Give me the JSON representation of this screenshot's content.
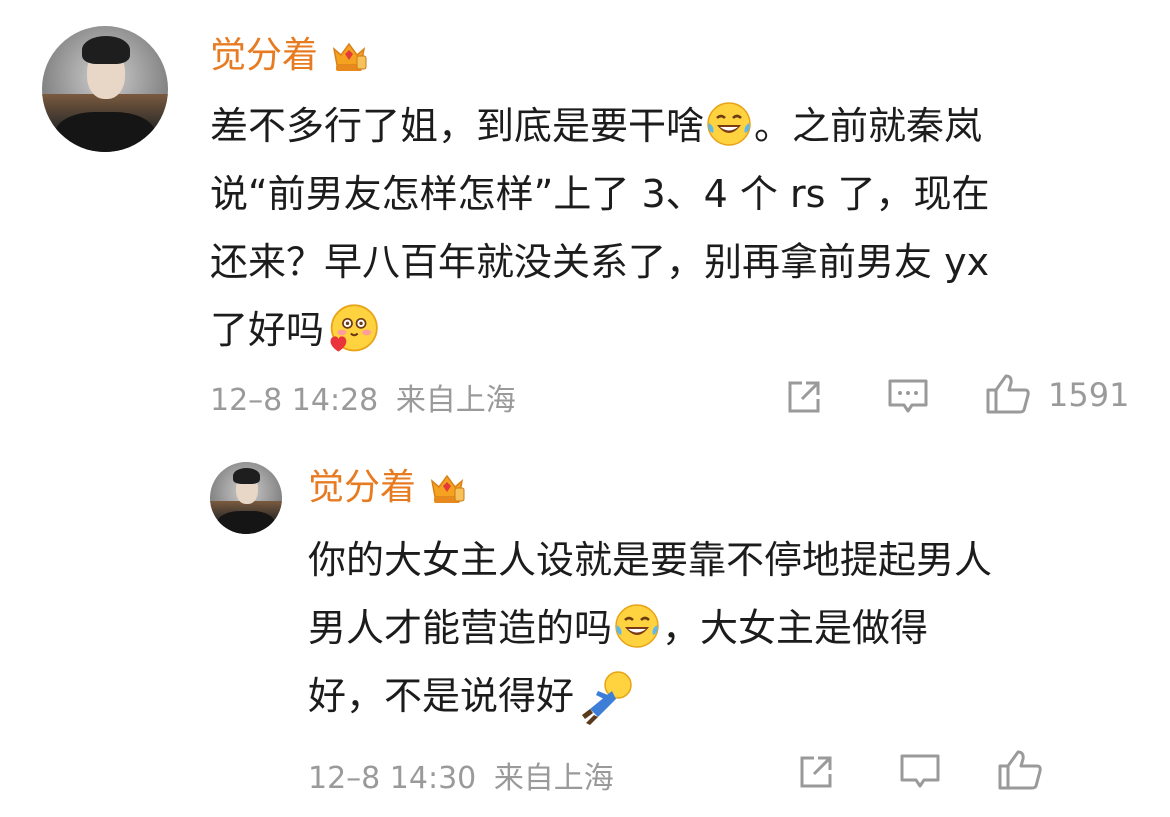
{
  "comment": {
    "author": "觉分着",
    "badge_icon": "vip-crown-icon",
    "lines": [
      "差不多行了姐，到底是要干啥",
      "。之前就秦岚",
      "说“前男友怎样怎样”上了 3、4 个 rs 了，现在",
      "还来？早八百年就没关系了，别再拿前男友 yx",
      "了好吗"
    ],
    "emojis": [
      "laugh-cry-emoji",
      "shy-heart-emoji"
    ],
    "time": "12–8 14:28",
    "location": "来自上海",
    "likes": "1591"
  },
  "reply": {
    "author": "觉分着",
    "badge_icon": "vip-crown-icon",
    "lines": [
      "你的大女主人设就是要靠不停地提起男人",
      "男人才能营造的吗",
      "，大女主是做得",
      "好，不是说得好"
    ],
    "emojis": [
      "laugh-cry-emoji",
      "fall-over-emoji"
    ],
    "time": "12–8 14:30",
    "location": "来自上海"
  },
  "colors": {
    "name": "#e77b22",
    "text": "#1c1c1c",
    "meta": "#9a9a9a"
  }
}
